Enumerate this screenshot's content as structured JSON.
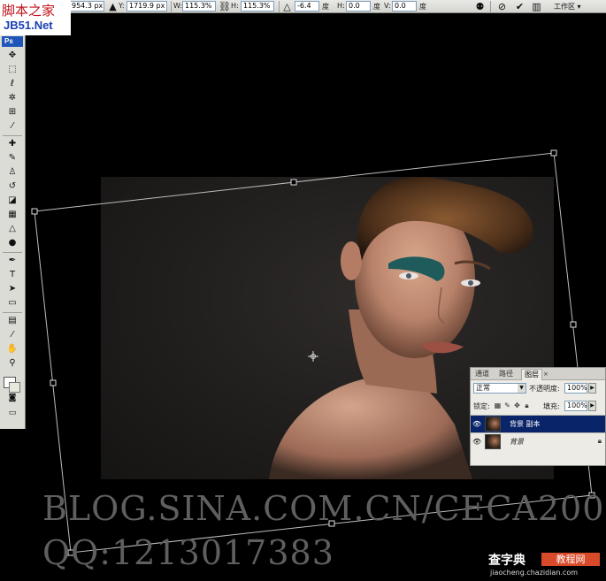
{
  "options_bar": {
    "x_value": "954.3 px",
    "y_label": "Y:",
    "y_value": "1719.9 px",
    "w_label": "W:",
    "w_value": "115.3%",
    "h_label": "H:",
    "h_value": "115.3%",
    "rotate_value": "-6.4",
    "rotate_unit": "度",
    "hskew_label": "H:",
    "hskew_value": "0.0",
    "hskew_unit": "度",
    "vskew_label": "V:",
    "vskew_value": "0.0",
    "vskew_unit": "度",
    "workspace_label": "工作区 ▾"
  },
  "site_logo_top": {
    "chinese": "脚本之家",
    "domain": "JB51.Net"
  },
  "toolbox": {
    "app_badge": "Ps",
    "tools": [
      {
        "name": "move-tool",
        "glyph": "✥"
      },
      {
        "name": "marquee-tool",
        "glyph": "⬚"
      },
      {
        "name": "lasso-tool",
        "glyph": "ℓ"
      },
      {
        "name": "magic-wand-tool",
        "glyph": "✲"
      },
      {
        "name": "crop-tool",
        "glyph": "⊞"
      },
      {
        "name": "slice-tool",
        "glyph": "⁄"
      },
      {
        "name": "healing-brush-tool",
        "glyph": "✚"
      },
      {
        "name": "brush-tool",
        "glyph": "✎"
      },
      {
        "name": "clone-stamp-tool",
        "glyph": "♙"
      },
      {
        "name": "history-brush-tool",
        "glyph": "↺"
      },
      {
        "name": "eraser-tool",
        "glyph": "◪"
      },
      {
        "name": "gradient-tool",
        "glyph": "▦"
      },
      {
        "name": "blur-tool",
        "glyph": "△"
      },
      {
        "name": "dodge-tool",
        "glyph": "●"
      },
      {
        "name": "pen-tool",
        "glyph": "✒"
      },
      {
        "name": "type-tool",
        "glyph": "T"
      },
      {
        "name": "path-selection-tool",
        "glyph": "➤"
      },
      {
        "name": "shape-tool",
        "glyph": "▭"
      },
      {
        "name": "notes-tool",
        "glyph": "▤"
      },
      {
        "name": "eyedropper-tool",
        "glyph": "⁄"
      },
      {
        "name": "hand-tool",
        "glyph": "✋"
      },
      {
        "name": "zoom-tool",
        "glyph": "⚲"
      }
    ]
  },
  "layers_panel": {
    "tabs": [
      "通道",
      "路径",
      "图层"
    ],
    "active_tab": "图层",
    "blend_mode": "正常",
    "opacity_label": "不透明度:",
    "opacity_value": "100%",
    "lock_label": "锁定:",
    "fill_label": "填充:",
    "fill_value": "100%",
    "layers": [
      {
        "name": "背景 副本",
        "selected": true,
        "visible": true
      },
      {
        "name": "背景",
        "selected": false,
        "visible": true,
        "locked": true
      }
    ]
  },
  "watermark": {
    "blog_url": "BLOG.SINA.COM.CN/CECA200",
    "qq": "QQ:1213017383"
  },
  "site_logo_bottom": {
    "chinese": "查字典",
    "tag": "教程网",
    "url": "jiaocheng.chazidian.com"
  }
}
